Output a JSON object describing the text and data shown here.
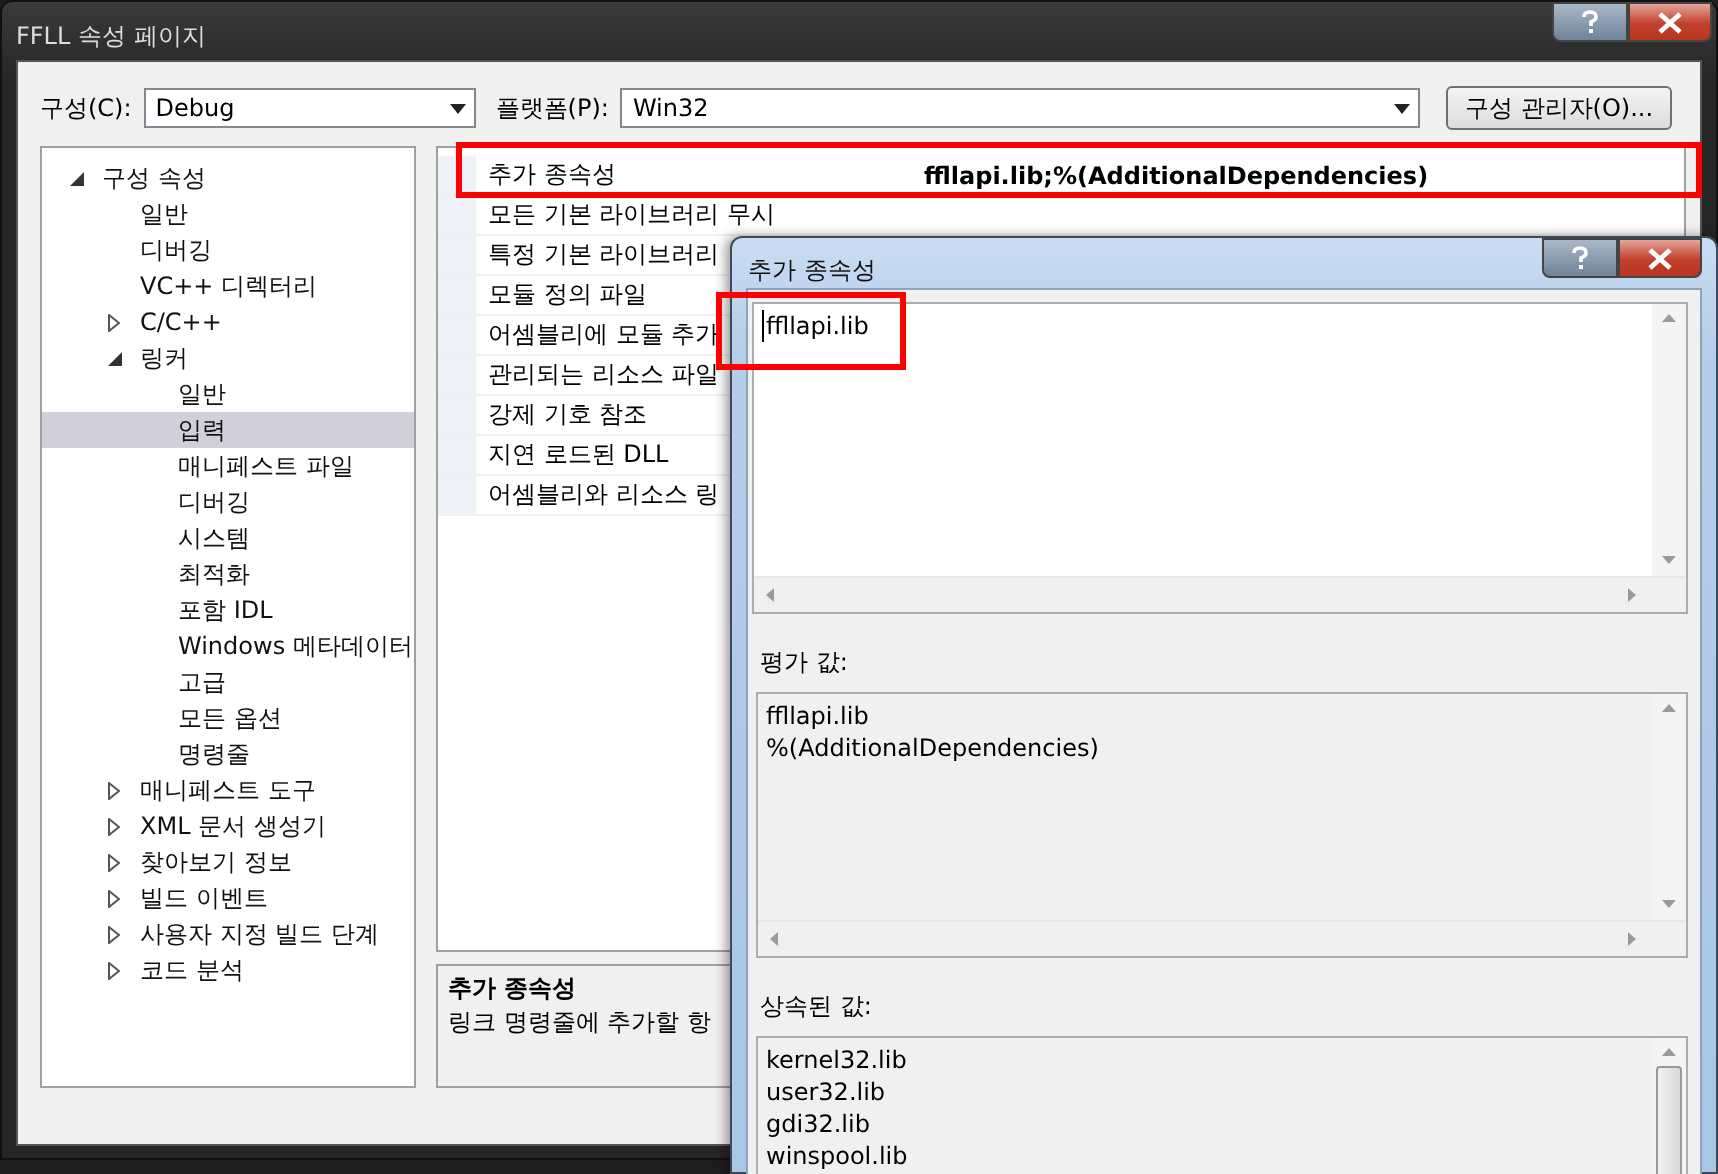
{
  "window": {
    "title": "FFLL 속성 페이지"
  },
  "toolbar": {
    "configuration": {
      "label": "구성(C):",
      "value": "Debug"
    },
    "platform": {
      "label": "플랫폼(P):",
      "value": "Win32"
    },
    "manager_button": "구성 관리자(O)..."
  },
  "tree": [
    {
      "label": "구성 속성",
      "expanded": true,
      "selected": false,
      "children": [
        {
          "label": "일반",
          "selected": false
        },
        {
          "label": "디버깅",
          "selected": false
        },
        {
          "label": "VC++ 디렉터리",
          "selected": false
        },
        {
          "label": "C/C++",
          "expanded": false,
          "selected": false
        },
        {
          "label": "링커",
          "expanded": true,
          "selected": false,
          "children": [
            {
              "label": "일반",
              "selected": false
            },
            {
              "label": "입력",
              "selected": true
            },
            {
              "label": "매니페스트 파일",
              "selected": false
            },
            {
              "label": "디버깅",
              "selected": false
            },
            {
              "label": "시스템",
              "selected": false
            },
            {
              "label": "최적화",
              "selected": false
            },
            {
              "label": "포함 IDL",
              "selected": false
            },
            {
              "label": "Windows 메타데이터",
              "selected": false
            },
            {
              "label": "고급",
              "selected": false
            },
            {
              "label": "모든 옵션",
              "selected": false
            },
            {
              "label": "명령줄",
              "selected": false
            }
          ]
        },
        {
          "label": "매니페스트 도구",
          "expanded": false,
          "selected": false
        },
        {
          "label": "XML 문서 생성기",
          "expanded": false,
          "selected": false
        },
        {
          "label": "찾아보기 정보",
          "expanded": false,
          "selected": false
        },
        {
          "label": "빌드 이벤트",
          "expanded": false,
          "selected": false
        },
        {
          "label": "사용자 지정 빌드 단계",
          "expanded": false,
          "selected": false
        },
        {
          "label": "코드 분석",
          "expanded": false,
          "selected": false
        }
      ]
    }
  ],
  "properties": [
    {
      "name": "추가 종속성",
      "value": "ffllapi.lib;%(AdditionalDependencies)"
    },
    {
      "name": "모든 기본 라이브러리 무시"
    },
    {
      "name": "특정 기본 라이브러리"
    },
    {
      "name": "모듈 정의 파일"
    },
    {
      "name": "어셈블리에 모듈 추가"
    },
    {
      "name": "관리되는 리소스 파일"
    },
    {
      "name": "강제 기호 참조"
    },
    {
      "name": "지연 로드된 DLL"
    },
    {
      "name": "어셈블리와 리소스 링"
    }
  ],
  "description": {
    "title": "추가 종속성",
    "text": "링크 명령줄에 추가할 항"
  },
  "dialog": {
    "title": "추가 종속성",
    "value": "ffllapi.lib",
    "evaluated_label": "평가 값:",
    "evaluated": [
      "ffllapi.lib",
      "%(AdditionalDependencies)"
    ],
    "inherited_label": "상속된 값:",
    "inherited": [
      "kernel32.lib",
      "user32.lib",
      "gdi32.lib",
      "winspool.lib"
    ]
  }
}
